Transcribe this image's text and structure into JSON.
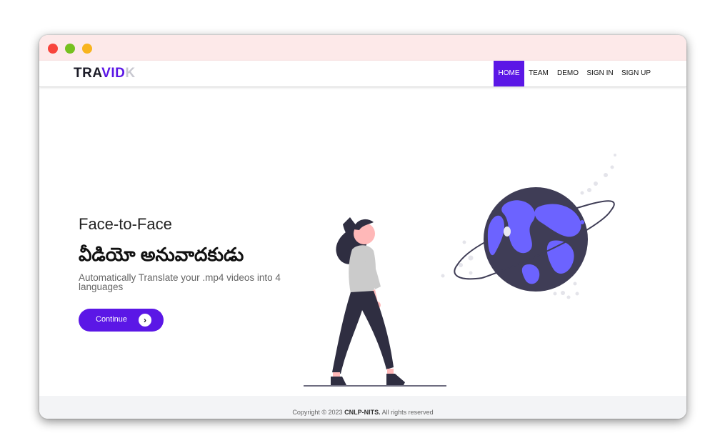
{
  "window": {
    "controls": [
      "close-dot",
      "minimize-dot",
      "maximize-dot"
    ]
  },
  "nav": {
    "logo_part1": "TRA",
    "logo_part2": "VID",
    "logo_part3": "K",
    "items": [
      {
        "label": "HOME",
        "active": true
      },
      {
        "label": "TEAM",
        "active": false
      },
      {
        "label": "DEMO",
        "active": false
      },
      {
        "label": "SIGN IN",
        "active": false
      },
      {
        "label": "SIGN UP",
        "active": false
      }
    ]
  },
  "hero": {
    "title": "Face-to-Face",
    "telugu_title": "వీడియో అనువాదకుడు",
    "subtitle": "Automatically Translate your .mp4 videos into 4 languages",
    "cta_label": "Continue",
    "cta_icon": "chevron-right-icon"
  },
  "footer": {
    "prefix": "Copyright © 2023 ",
    "brand": "CNLP-NITS.",
    "suffix": " All rights reserved"
  },
  "colors": {
    "accent": "#5b17e6",
    "titlebar": "#fde9e9",
    "globe_dark": "#3f3d56",
    "globe_land": "#6c63ff",
    "skin": "#ffb8b8"
  }
}
